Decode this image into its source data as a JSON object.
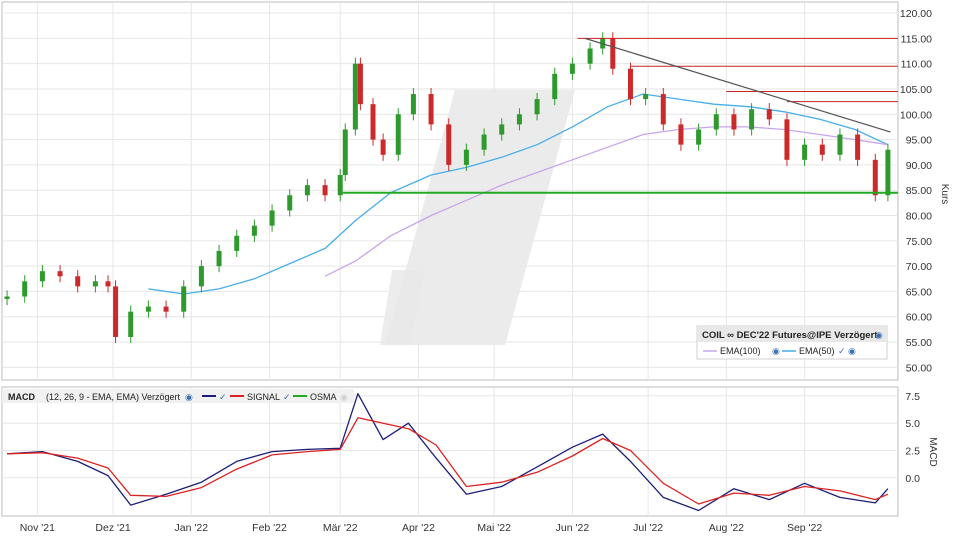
{
  "chart_data": [
    {
      "type": "candlestick",
      "panel": "price",
      "ylabel": "Kurs",
      "ylim": [
        47.5,
        121
      ],
      "y_ticks": [
        "120.00",
        "115.00",
        "110.00",
        "105.00",
        "100.00",
        "95.00",
        "90.00",
        "85.00",
        "80.00",
        "75.00",
        "70.00",
        "65.00",
        "60.00",
        "55.00",
        "50.00"
      ],
      "x_ticks": [
        "Nov '21",
        "Dez '21",
        "Jan '22",
        "Feb '22",
        "Mär '22",
        "Apr '22",
        "Mai '22",
        "Jun '22",
        "Jul '22",
        "Aug '22",
        "Sep '22"
      ],
      "legend": {
        "title": "COIL ∞ DEC'22 Futures@IPE Verzögert",
        "items": [
          {
            "name": "EMA(100)",
            "color": "#c9a4ec"
          },
          {
            "name": "EMA(50)",
            "color": "#46aee8"
          }
        ],
        "placement": "bottom-right"
      },
      "series": [
        {
          "name": "close",
          "color_up": "#2e9a2e",
          "color_down": "#cc2a2a",
          "x": [
            "2021-10-20",
            "2021-10-27",
            "2021-11-03",
            "2021-11-10",
            "2021-11-17",
            "2021-11-24",
            "2021-11-29",
            "2021-12-02",
            "2021-12-08",
            "2021-12-15",
            "2021-12-22",
            "2021-12-29",
            "2022-01-05",
            "2022-01-12",
            "2022-01-19",
            "2022-01-26",
            "2022-02-02",
            "2022-02-09",
            "2022-02-16",
            "2022-02-23",
            "2022-03-01",
            "2022-03-03",
            "2022-03-07",
            "2022-03-09",
            "2022-03-14",
            "2022-03-18",
            "2022-03-24",
            "2022-03-30",
            "2022-04-06",
            "2022-04-13",
            "2022-04-20",
            "2022-04-27",
            "2022-05-04",
            "2022-05-11",
            "2022-05-18",
            "2022-05-25",
            "2022-06-01",
            "2022-06-08",
            "2022-06-13",
            "2022-06-17",
            "2022-06-24",
            "2022-06-30",
            "2022-07-07",
            "2022-07-14",
            "2022-07-21",
            "2022-07-28",
            "2022-08-04",
            "2022-08-11",
            "2022-08-18",
            "2022-08-25",
            "2022-09-01",
            "2022-09-08",
            "2022-09-15",
            "2022-09-22",
            "2022-09-29",
            "2022-10-04"
          ],
          "values": [
            64,
            67,
            69,
            68,
            66,
            67,
            66,
            56,
            61,
            62,
            61,
            66,
            70,
            73,
            76,
            78,
            81,
            84,
            86,
            84,
            88,
            97,
            110,
            102,
            95,
            92,
            100,
            104,
            98,
            90,
            93,
            96,
            98,
            100,
            103,
            108,
            110,
            113,
            115,
            109,
            103,
            104,
            98,
            94,
            97,
            100,
            97,
            101,
            99,
            91,
            94,
            92,
            96,
            91,
            84,
            93
          ]
        }
      ],
      "lines": [
        {
          "name": "EMA(50)",
          "color": "#46aee8",
          "x": [
            "2021-12-15",
            "2021-12-29",
            "2022-01-12",
            "2022-01-26",
            "2022-02-09",
            "2022-02-23",
            "2022-03-07",
            "2022-03-21",
            "2022-04-06",
            "2022-04-20",
            "2022-05-04",
            "2022-05-18",
            "2022-06-01",
            "2022-06-15",
            "2022-06-29",
            "2022-07-13",
            "2022-07-27",
            "2022-08-10",
            "2022-08-24",
            "2022-09-07",
            "2022-09-21",
            "2022-10-04"
          ],
          "values": [
            65.5,
            64.5,
            65.5,
            67.5,
            70.5,
            73.5,
            79,
            84.5,
            88,
            89.5,
            91.5,
            94,
            97.5,
            101.5,
            104,
            103,
            102,
            101.5,
            100.5,
            99,
            97,
            94
          ]
        },
        {
          "name": "EMA(100)",
          "color": "#c9a4ec",
          "x": [
            "2022-02-23",
            "2022-03-07",
            "2022-03-21",
            "2022-04-06",
            "2022-04-20",
            "2022-05-04",
            "2022-05-18",
            "2022-06-01",
            "2022-06-15",
            "2022-06-29",
            "2022-07-13",
            "2022-07-27",
            "2022-08-10",
            "2022-08-24",
            "2022-09-07",
            "2022-09-21",
            "2022-10-04"
          ],
          "values": [
            68,
            71,
            76,
            80,
            83,
            86,
            88.5,
            91,
            93.5,
            96,
            97,
            97.5,
            97.5,
            97,
            96,
            95,
            94
          ]
        }
      ],
      "annotations": [
        {
          "type": "support",
          "value": 84.5,
          "color": "#22aa22"
        },
        {
          "type": "resistance",
          "value": 115,
          "color": "#cc2222"
        },
        {
          "type": "resistance",
          "value": 109.5,
          "color": "#cc2222"
        },
        {
          "type": "resistance",
          "value": 104.5,
          "color": "#cc2222"
        },
        {
          "type": "resistance",
          "value": 102.5,
          "color": "#cc2222"
        },
        {
          "type": "trendline",
          "from": [
            "2022-06-06",
            115
          ],
          "to": [
            "2022-10-05",
            96.5
          ],
          "color": "#555555"
        }
      ],
      "grid": true
    },
    {
      "type": "line",
      "panel": "macd",
      "ylabel": "MACD",
      "ylim": [
        -3.5,
        8.5
      ],
      "y_ticks": [
        "7.5",
        "5.0",
        "2.5",
        "0.0"
      ],
      "legend": {
        "title": "MACD",
        "params": "(12, 26, 9 - EMA, EMA) Verzögert",
        "items": [
          {
            "name": "",
            "color": "#1e1e78"
          },
          {
            "name": "SIGNAL",
            "color": "#dd2222"
          },
          {
            "name": "OSMA",
            "color": "#22aa22"
          }
        ],
        "placement": "top-left"
      },
      "series": [
        {
          "name": "MACD",
          "color": "#1e1e78",
          "x": [
            "2021-10-20",
            "2021-11-03",
            "2021-11-17",
            "2021-11-29",
            "2021-12-08",
            "2021-12-22",
            "2022-01-05",
            "2022-01-19",
            "2022-02-02",
            "2022-02-16",
            "2022-03-01",
            "2022-03-08",
            "2022-03-18",
            "2022-03-28",
            "2022-04-08",
            "2022-04-20",
            "2022-05-04",
            "2022-05-18",
            "2022-06-01",
            "2022-06-13",
            "2022-06-24",
            "2022-07-07",
            "2022-07-21",
            "2022-08-04",
            "2022-08-18",
            "2022-09-01",
            "2022-09-15",
            "2022-09-29",
            "2022-10-04"
          ],
          "values": [
            2.2,
            2.4,
            1.5,
            0.2,
            -2.5,
            -1.5,
            -0.4,
            1.5,
            2.4,
            2.6,
            2.7,
            7.7,
            3.5,
            5.0,
            1.8,
            -1.5,
            -0.8,
            1.0,
            2.8,
            4.0,
            1.5,
            -1.8,
            -3.0,
            -1.0,
            -2.0,
            -0.5,
            -1.8,
            -2.3,
            -1.0
          ]
        },
        {
          "name": "SIGNAL",
          "color": "#dd2222",
          "x": [
            "2021-10-20",
            "2021-11-03",
            "2021-11-17",
            "2021-11-29",
            "2021-12-08",
            "2021-12-22",
            "2022-01-05",
            "2022-01-19",
            "2022-02-02",
            "2022-02-16",
            "2022-03-01",
            "2022-03-08",
            "2022-03-18",
            "2022-03-28",
            "2022-04-08",
            "2022-04-20",
            "2022-05-04",
            "2022-05-18",
            "2022-06-01",
            "2022-06-13",
            "2022-06-24",
            "2022-07-07",
            "2022-07-21",
            "2022-08-04",
            "2022-08-18",
            "2022-09-01",
            "2022-09-15",
            "2022-09-29",
            "2022-10-04"
          ],
          "values": [
            2.2,
            2.3,
            1.8,
            0.9,
            -1.6,
            -1.7,
            -0.9,
            0.8,
            2.1,
            2.4,
            2.6,
            5.5,
            5.0,
            4.5,
            3.0,
            -0.8,
            -0.4,
            0.5,
            2.0,
            3.6,
            2.5,
            -0.5,
            -2.4,
            -1.4,
            -1.6,
            -0.8,
            -1.2,
            -2.0,
            -1.5
          ]
        }
      ],
      "grid": true
    }
  ]
}
